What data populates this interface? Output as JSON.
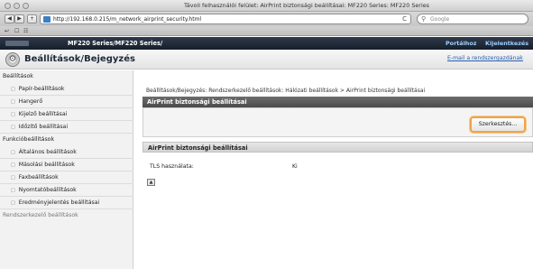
{
  "browser": {
    "window_title": "Távoli felhasználói felület: AirPrint biztonsági beállításai: MF220 Series: MF220 Series",
    "url": "http://192.168.0.215/m_network_airprint_security.html",
    "search_placeholder": "Google",
    "back_glyph": "◀",
    "forward_glyph": "▶",
    "add_glyph": "+",
    "reload_glyph": "C",
    "bookmarks": [
      "↩",
      "☐",
      "☷"
    ]
  },
  "brandbar": {
    "title": "MF220 Series/MF220 Series/",
    "portal_link": "Portálhoz",
    "logout_link": "Kijelentkezés"
  },
  "page": {
    "title": "Beállítások/Bejegyzés",
    "email_link": "E-mail a rendszergazdának"
  },
  "sidebar": {
    "sections": [
      {
        "label": "Beállítások",
        "items": [
          "Papír-beállítások",
          "Hangerő",
          "Kijelző beállításai",
          "Időzítő beállításai"
        ]
      },
      {
        "label": "Funkcióbeállítások",
        "items": [
          "Általános beállítások",
          "Másolási beállítások",
          "Faxbeállítások",
          "Nyomtatóbeállítások",
          "Eredményjelentés beállításai"
        ]
      },
      {
        "label": "Rendszerkezelő beállítások",
        "items": []
      }
    ]
  },
  "main": {
    "breadcrumb": "Beállítások/Bejegyzés: Rendszerkezelő beállítások: Hálózati beállítások > AirPrint biztonsági beállításai",
    "panel1_title": "AirPrint biztonsági beállításai",
    "edit_button": "Szerkesztés...",
    "panel2_title": "AirPrint biztonsági beállításai",
    "row_label": "TLS használata:",
    "row_value": "Ki",
    "top_icon_glyph": "▲"
  }
}
